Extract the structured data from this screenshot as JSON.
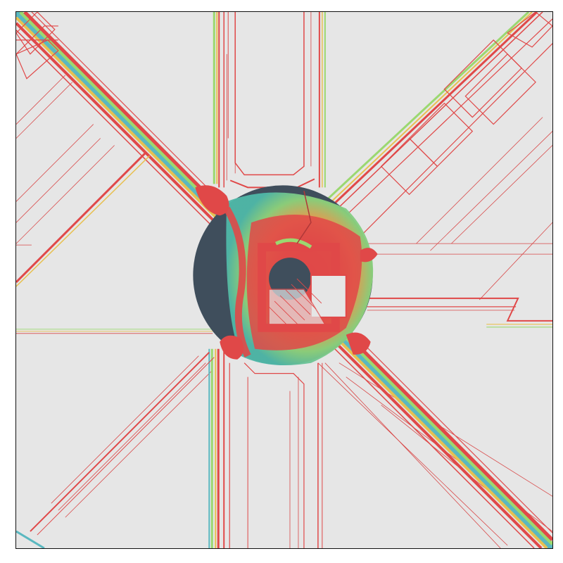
{
  "figure": {
    "background_color": "#e6e6e6",
    "border_color": "#111111",
    "colors": {
      "red": "#e04848",
      "orange": "#ec8a4a",
      "yellow": "#e8e062",
      "green": "#9bd870",
      "teal": "#4fbfa0",
      "cyan": "#5ab8c0",
      "dark_slate": "#3f4e5c"
    }
  }
}
